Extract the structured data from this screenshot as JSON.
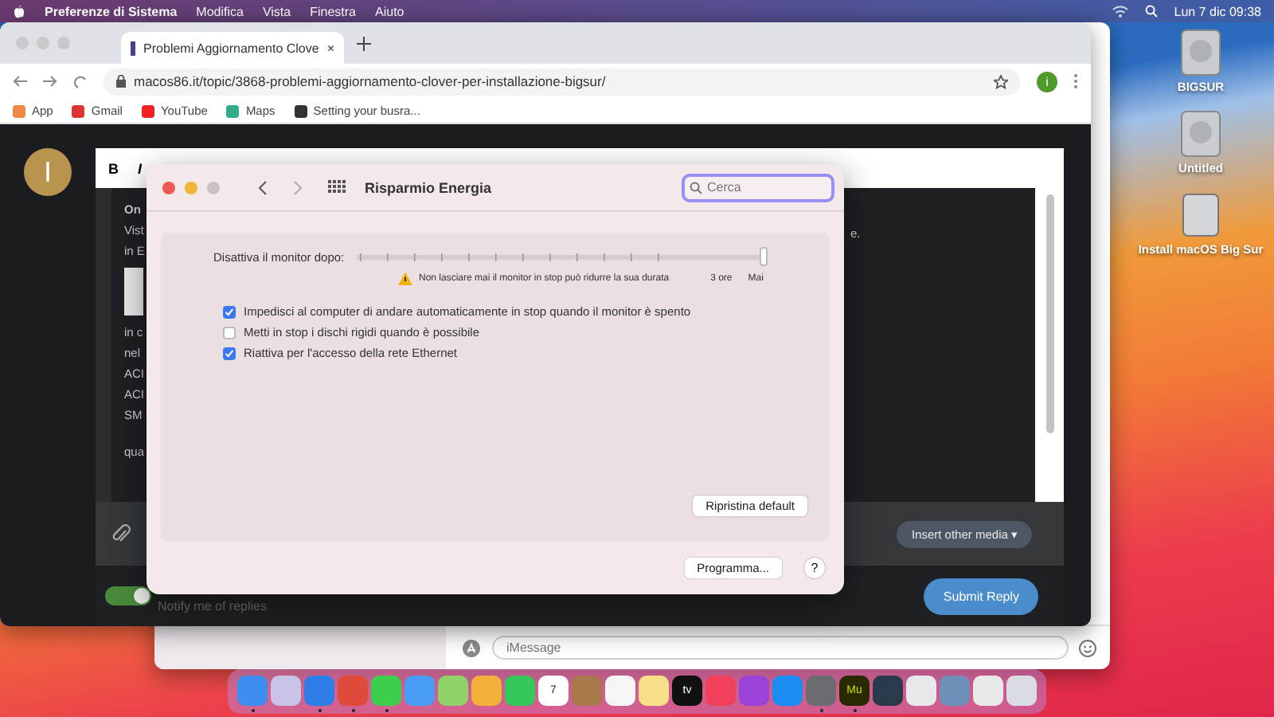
{
  "menu_bar": {
    "app": "Preferenze di Sistema",
    "menus": [
      "Modifica",
      "Vista",
      "Finestra",
      "Aiuto"
    ],
    "clock": "Lun 7 dic  09:38"
  },
  "desktop_icons": [
    {
      "label": "BIGSUR",
      "kind": "disk"
    },
    {
      "label": "Untitled",
      "kind": "disk"
    },
    {
      "label": "Install macOS Big Sur",
      "kind": "installer"
    }
  ],
  "browser": {
    "tab": {
      "title": "Problemi Aggiornamento Clove",
      "close": "×",
      "selected": true
    },
    "url": "macos86.it/topic/3868-problemi-aggiornamento-clover-per-installazione-bigsur/",
    "profile": "i",
    "bookmarks": [
      "App",
      "Gmail",
      "YouTube",
      "Maps",
      "Setting your busra..."
    ],
    "page": {
      "avatar": "I",
      "editor_tools": [
        "B",
        "I"
      ],
      "fragments": [
        {
          "text": "On",
          "kind": "bold"
        },
        {
          "text": "Vist",
          "kind": "text"
        },
        {
          "text": "in E",
          "kind": "text"
        },
        {
          "kind": "image"
        },
        {
          "text": "in c",
          "kind": "text"
        },
        {
          "text": "nel",
          "kind": "text"
        },
        {
          "text": "ACI",
          "kind": "text"
        },
        {
          "text": "ACI",
          "kind": "text"
        },
        {
          "text": "SM",
          "kind": "text"
        },
        {
          "text": "qua",
          "kind": "gap"
        }
      ],
      "right_fragment": "e.",
      "insert_media": "Insert other media",
      "insert_media_caret": "▾",
      "notify": {
        "label": "Notify me of replies",
        "on": true
      },
      "submit": "Submit Reply"
    }
  },
  "messages": {
    "placeholder": "iMessage"
  },
  "prefs": {
    "title": "Risparmio Energia",
    "search": {
      "placeholder": "Cerca"
    },
    "slider": {
      "label": "Disattiva il monitor dopo:",
      "level": 1,
      "warning": "Non lasciare mai il monitor in stop può ridurre la sua durata",
      "tick_labels": [
        "3 ore",
        "Mai"
      ]
    },
    "options": [
      {
        "label": "Impedisci al computer di andare automaticamente in stop quando il monitor è spento",
        "checked": true
      },
      {
        "label": "Metti in stop i dischi rigidi quando è possibile",
        "checked": false
      },
      {
        "label": "Riattiva per l'accesso della rete Ethernet",
        "checked": true
      }
    ],
    "reset": "Ripristina default",
    "schedule": "Programma...",
    "help": "?"
  },
  "dock": [
    {
      "color": "#3d8ef0",
      "running": true
    },
    {
      "color": "#c9c3e8",
      "running": false
    },
    {
      "color": "#2f7ee8",
      "running": true
    },
    {
      "color": "#e04a3a",
      "running": true
    },
    {
      "color": "#3ccf4e",
      "running": true
    },
    {
      "color": "#4a9df5",
      "running": false
    },
    {
      "color": "#8fd26a",
      "running": false
    },
    {
      "color": "#f4b13a",
      "running": false
    },
    {
      "color": "#34c759",
      "running": false
    },
    {
      "color": "#ffffff",
      "running": false,
      "glyph": "7"
    },
    {
      "color": "#a8794a",
      "running": false
    },
    {
      "color": "#f5f5f5",
      "running": false
    },
    {
      "color": "#f8e08a",
      "running": false
    },
    {
      "color": "#111111",
      "running": false,
      "glyph": "tv"
    },
    {
      "color": "#f2405a",
      "running": false
    },
    {
      "color": "#9b42d8",
      "running": false
    },
    {
      "color": "#1a8cf2",
      "running": false
    },
    {
      "color": "#6c6c70",
      "running": true
    },
    {
      "color": "#2a2a00",
      "running": true,
      "glyph": "Mu"
    },
    {
      "color": "#2a3a4a",
      "running": false
    },
    {
      "color": "#e8e8ea",
      "running": false
    },
    {
      "color": "#6d8fb8",
      "running": false
    },
    {
      "color": "#e9e9e9",
      "running": false
    },
    {
      "color": "#d9dde3",
      "running": false
    }
  ]
}
